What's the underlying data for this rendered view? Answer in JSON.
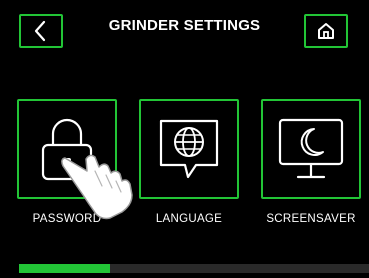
{
  "header": {
    "title": "GRINDER SETTINGS",
    "back_icon": "chevron-left-icon",
    "home_icon": "home-icon"
  },
  "tiles": [
    {
      "label": "PASSWORD",
      "icon": "lock-icon"
    },
    {
      "label": "LANGUAGE",
      "icon": "globe-speech-icon"
    },
    {
      "label": "SCREENSAVER",
      "icon": "monitor-moon-icon"
    }
  ],
  "overlay": {
    "icon": "pointing-hand-icon"
  },
  "progress": {
    "fraction": 0.26
  },
  "colors": {
    "accent": "#22c536",
    "background": "#000000",
    "text": "#ffffff",
    "track": "#2a2a2a"
  }
}
